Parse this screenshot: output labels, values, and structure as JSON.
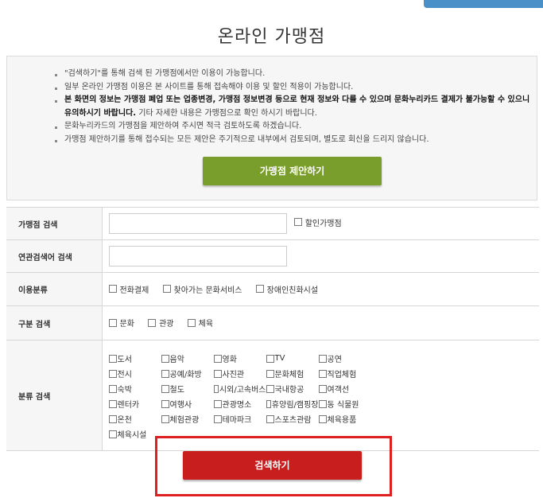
{
  "page_title": "온라인 가맹점",
  "notice": {
    "items": [
      {
        "bold": "",
        "text": "\"검색하기\"를 통해 검색 된 가맹점에서만 이용이 가능합니다."
      },
      {
        "bold": "",
        "text": "일부 온라인 가맹점 이용은 본 사이트를 통해 접속해야 이용 및 할인 적용이 가능합니다."
      },
      {
        "bold": "본 화면의 정보는 가맹점 폐업 또는 업종변경, 가맹점 정보변경 등으로 현재 정보와 다를 수 있으며 문화누리카드 결제가 불가능할 수 있으니 유의하시기 바랍니다.",
        "text": " 기타 자세한 내용은 가맹점으로 확인 하시기 바랍니다."
      },
      {
        "bold": "",
        "text": "문화누리카드의 가맹점을 제안하여 주시면 적극 검토하도록 하겠습니다."
      },
      {
        "bold": "",
        "text": "가맹점 제안하기를 통해 접수되는 모든 제안은 주기적으로 내부에서 검토되며, 별도로 회신을 드리지 않습니다."
      }
    ],
    "propose_button": "가맹점 제안하기"
  },
  "search_form": {
    "shop_search": {
      "label": "가맹점 검색",
      "value": "",
      "discount_label": "할인가맹점"
    },
    "related_search": {
      "label": "연관검색어 검색",
      "value": ""
    },
    "usage": {
      "label": "이용분류",
      "options": [
        "전화결제",
        "찾아가는 문화서비스",
        "장애인친화시설"
      ]
    },
    "division": {
      "label": "구분 검색",
      "options": [
        "문화",
        "관광",
        "체육"
      ]
    },
    "category": {
      "label": "분류 검색",
      "options": [
        "도서",
        "음악",
        "영화",
        "TV",
        "공연",
        "전시",
        "공예/화방",
        "사진관",
        "문화체험",
        "직업체험",
        "숙박",
        "철도",
        "시외/고속버스",
        "국내항공",
        "여객선",
        "렌터카",
        "여행사",
        "관광명소",
        "휴양림/캠핑장",
        "동 식물원",
        "온천",
        "체험관광",
        "테마파크",
        "스포츠관람",
        "체육용품",
        "체육시설"
      ]
    }
  },
  "search_button": "검색하기"
}
